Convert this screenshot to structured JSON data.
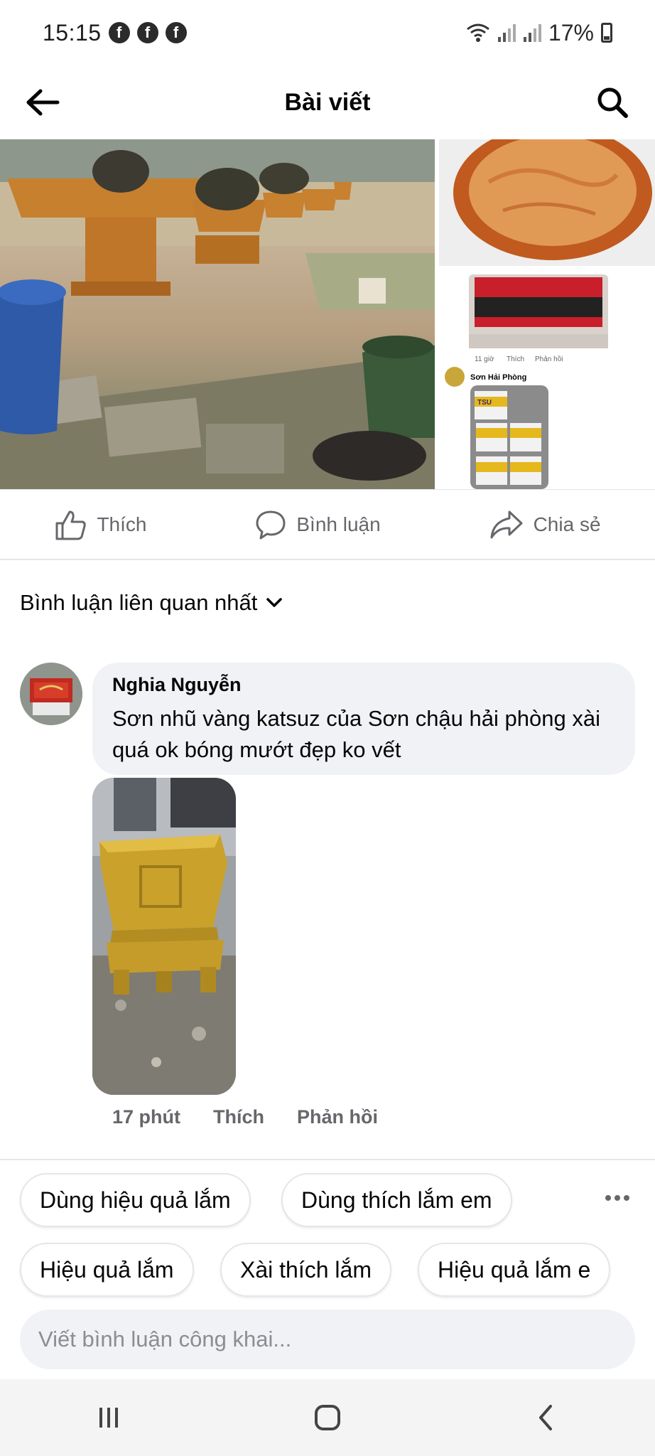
{
  "status_bar": {
    "time": "15:15",
    "notification_icons": [
      "facebook-icon",
      "facebook-icon",
      "facebook-icon"
    ],
    "battery": "17%"
  },
  "header": {
    "title": "Bài viết"
  },
  "media": {
    "thumb_meta": [
      "11 giờ",
      "Thích",
      "Phản hồi"
    ],
    "thumb_author": "Sơn Hải Phòng",
    "thumb_can_label": "TSU"
  },
  "actions": {
    "like": "Thích",
    "comment": "Bình luận",
    "share": "Chia sẻ"
  },
  "sort": {
    "label": "Bình luận liên quan nhất"
  },
  "comment": {
    "author": "Nghia Nguyễn",
    "text": "Sơn nhũ vàng katsuz của Sơn chậu hải phòng xài quá ok bóng mướt đẹp ko vết",
    "time": "17 phút",
    "like": "Thích",
    "reply": "Phản hồi"
  },
  "quick_replies": [
    "Dùng hiệu quả lắm",
    "Dùng thích lắm em",
    "Hiệu quả lắm",
    "Xài thích lắm",
    "Hiệu quả lắm e"
  ],
  "input": {
    "placeholder": "Viết bình luận công khai..."
  },
  "colors": {
    "text_primary": "#050505",
    "text_secondary": "#65676b",
    "bubble_bg": "#f0f2f5",
    "divider": "#e4e6eb"
  }
}
